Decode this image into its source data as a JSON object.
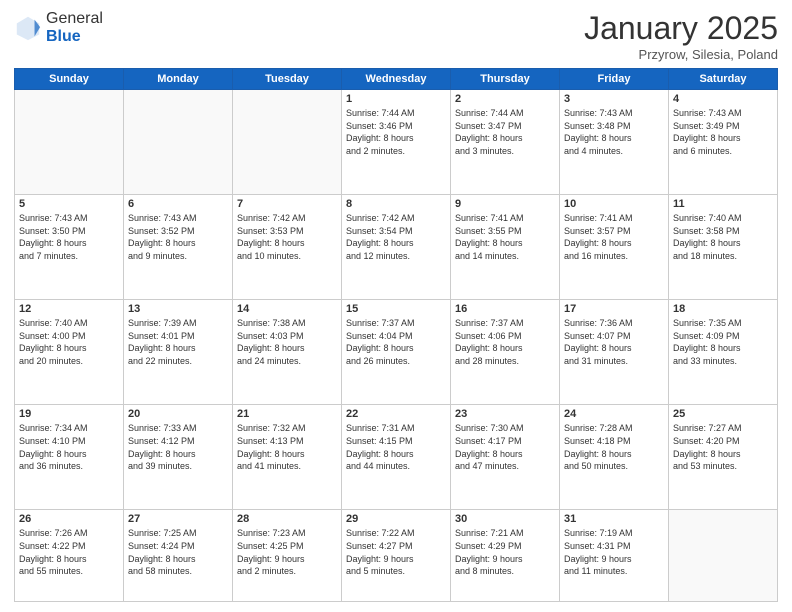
{
  "header": {
    "logo_general": "General",
    "logo_blue": "Blue",
    "month_title": "January 2025",
    "location": "Przyrow, Silesia, Poland"
  },
  "weekdays": [
    "Sunday",
    "Monday",
    "Tuesday",
    "Wednesday",
    "Thursday",
    "Friday",
    "Saturday"
  ],
  "rows": [
    [
      {
        "day": "",
        "info": ""
      },
      {
        "day": "",
        "info": ""
      },
      {
        "day": "",
        "info": ""
      },
      {
        "day": "1",
        "info": "Sunrise: 7:44 AM\nSunset: 3:46 PM\nDaylight: 8 hours\nand 2 minutes."
      },
      {
        "day": "2",
        "info": "Sunrise: 7:44 AM\nSunset: 3:47 PM\nDaylight: 8 hours\nand 3 minutes."
      },
      {
        "day": "3",
        "info": "Sunrise: 7:43 AM\nSunset: 3:48 PM\nDaylight: 8 hours\nand 4 minutes."
      },
      {
        "day": "4",
        "info": "Sunrise: 7:43 AM\nSunset: 3:49 PM\nDaylight: 8 hours\nand 6 minutes."
      }
    ],
    [
      {
        "day": "5",
        "info": "Sunrise: 7:43 AM\nSunset: 3:50 PM\nDaylight: 8 hours\nand 7 minutes."
      },
      {
        "day": "6",
        "info": "Sunrise: 7:43 AM\nSunset: 3:52 PM\nDaylight: 8 hours\nand 9 minutes."
      },
      {
        "day": "7",
        "info": "Sunrise: 7:42 AM\nSunset: 3:53 PM\nDaylight: 8 hours\nand 10 minutes."
      },
      {
        "day": "8",
        "info": "Sunrise: 7:42 AM\nSunset: 3:54 PM\nDaylight: 8 hours\nand 12 minutes."
      },
      {
        "day": "9",
        "info": "Sunrise: 7:41 AM\nSunset: 3:55 PM\nDaylight: 8 hours\nand 14 minutes."
      },
      {
        "day": "10",
        "info": "Sunrise: 7:41 AM\nSunset: 3:57 PM\nDaylight: 8 hours\nand 16 minutes."
      },
      {
        "day": "11",
        "info": "Sunrise: 7:40 AM\nSunset: 3:58 PM\nDaylight: 8 hours\nand 18 minutes."
      }
    ],
    [
      {
        "day": "12",
        "info": "Sunrise: 7:40 AM\nSunset: 4:00 PM\nDaylight: 8 hours\nand 20 minutes."
      },
      {
        "day": "13",
        "info": "Sunrise: 7:39 AM\nSunset: 4:01 PM\nDaylight: 8 hours\nand 22 minutes."
      },
      {
        "day": "14",
        "info": "Sunrise: 7:38 AM\nSunset: 4:03 PM\nDaylight: 8 hours\nand 24 minutes."
      },
      {
        "day": "15",
        "info": "Sunrise: 7:37 AM\nSunset: 4:04 PM\nDaylight: 8 hours\nand 26 minutes."
      },
      {
        "day": "16",
        "info": "Sunrise: 7:37 AM\nSunset: 4:06 PM\nDaylight: 8 hours\nand 28 minutes."
      },
      {
        "day": "17",
        "info": "Sunrise: 7:36 AM\nSunset: 4:07 PM\nDaylight: 8 hours\nand 31 minutes."
      },
      {
        "day": "18",
        "info": "Sunrise: 7:35 AM\nSunset: 4:09 PM\nDaylight: 8 hours\nand 33 minutes."
      }
    ],
    [
      {
        "day": "19",
        "info": "Sunrise: 7:34 AM\nSunset: 4:10 PM\nDaylight: 8 hours\nand 36 minutes."
      },
      {
        "day": "20",
        "info": "Sunrise: 7:33 AM\nSunset: 4:12 PM\nDaylight: 8 hours\nand 39 minutes."
      },
      {
        "day": "21",
        "info": "Sunrise: 7:32 AM\nSunset: 4:13 PM\nDaylight: 8 hours\nand 41 minutes."
      },
      {
        "day": "22",
        "info": "Sunrise: 7:31 AM\nSunset: 4:15 PM\nDaylight: 8 hours\nand 44 minutes."
      },
      {
        "day": "23",
        "info": "Sunrise: 7:30 AM\nSunset: 4:17 PM\nDaylight: 8 hours\nand 47 minutes."
      },
      {
        "day": "24",
        "info": "Sunrise: 7:28 AM\nSunset: 4:18 PM\nDaylight: 8 hours\nand 50 minutes."
      },
      {
        "day": "25",
        "info": "Sunrise: 7:27 AM\nSunset: 4:20 PM\nDaylight: 8 hours\nand 53 minutes."
      }
    ],
    [
      {
        "day": "26",
        "info": "Sunrise: 7:26 AM\nSunset: 4:22 PM\nDaylight: 8 hours\nand 55 minutes."
      },
      {
        "day": "27",
        "info": "Sunrise: 7:25 AM\nSunset: 4:24 PM\nDaylight: 8 hours\nand 58 minutes."
      },
      {
        "day": "28",
        "info": "Sunrise: 7:23 AM\nSunset: 4:25 PM\nDaylight: 9 hours\nand 2 minutes."
      },
      {
        "day": "29",
        "info": "Sunrise: 7:22 AM\nSunset: 4:27 PM\nDaylight: 9 hours\nand 5 minutes."
      },
      {
        "day": "30",
        "info": "Sunrise: 7:21 AM\nSunset: 4:29 PM\nDaylight: 9 hours\nand 8 minutes."
      },
      {
        "day": "31",
        "info": "Sunrise: 7:19 AM\nSunset: 4:31 PM\nDaylight: 9 hours\nand 11 minutes."
      },
      {
        "day": "",
        "info": ""
      }
    ]
  ]
}
